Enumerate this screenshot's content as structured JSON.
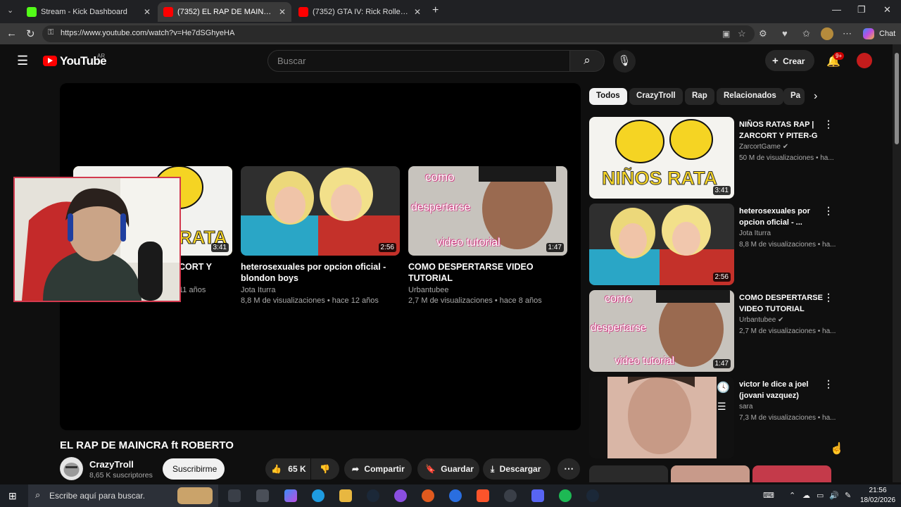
{
  "browser": {
    "tabs": [
      {
        "label": "Stream - Kick Dashboard",
        "favicon_color": "#53fc18"
      },
      {
        "label": "(7352) EL RAP DE MAINCRA ft ROBERTO",
        "favicon_color": "#ff0000"
      },
      {
        "label": "(7352) GTA IV: Rick Rolled EFLC (Or...",
        "favicon_color": "#ff0000"
      }
    ],
    "url": "https://www.youtube.com/watch?v=He7dSGhyeHA",
    "chat_label": "Chat"
  },
  "youtube": {
    "logo_text": "YouTube",
    "region": "AR",
    "search_placeholder": "Buscar",
    "create_label": "Crear",
    "notif_badge": "9+",
    "player_end_cards": [
      {
        "title": "NIÑOS RATAS RAP | ZARCORT Y PITER-G",
        "title_visible": "CORT Y",
        "meta_visible": "11 años",
        "duration": "3:41"
      },
      {
        "title": "heterosexuales por opcion oficial - blondon boys",
        "channel": "Jota Iturra",
        "meta": "8,8 M de visualizaciones • hace 12 años",
        "duration": "2:56"
      },
      {
        "title": "COMO DESPERTARSE VIDEO TUTORIAL",
        "channel": "Urbantubee",
        "meta": "2,7 M de visualizaciones • hace 8 años",
        "duration": "1:47",
        "thumb_text": [
          "como",
          "despertarse",
          "video tutorial"
        ]
      }
    ],
    "video": {
      "title": "EL RAP DE MAINCRA ft ROBERTO",
      "channel": "CrazyTroll",
      "subscribers": "8,65 K suscriptores",
      "subscribe_label": "Suscribirme",
      "likes": "65 K",
      "share_label": "Compartir",
      "save_label": "Guardar",
      "download_label": "Descargar"
    },
    "chips": [
      "Todos",
      "CrazyTroll",
      "Rap",
      "Relacionados",
      "Pa"
    ],
    "recommendations": [
      {
        "title": "NIÑOS RATAS RAP | ZARCORT Y PITER-G",
        "channel": "ZarcortGame",
        "views": "50 M de visualizaciones • ha...",
        "duration": "3:41",
        "thumb_text": "NIÑOS RATA",
        "verified": true
      },
      {
        "title": "heterosexuales por opcion oficial - ...",
        "channel": "Jota Iturra",
        "views": "8,8 M de visualizaciones • ha...",
        "duration": "2:56",
        "verified": false
      },
      {
        "title": "COMO DESPERTARSE VIDEO TUTORIAL",
        "channel": "Urbantubee",
        "views": "2,7 M de visualizaciones • ha...",
        "duration": "1:47",
        "verified": true
      },
      {
        "title": "victor le dice a joel (jovani vazquez)",
        "channel": "sara",
        "views": "7,3 M de visualizaciones • ha...",
        "verified": false
      }
    ]
  },
  "taskbar": {
    "search_placeholder": "Escribe aquí para buscar.",
    "time": "21:56",
    "date": "18/02/2026"
  },
  "colors": {
    "accent_red": "#ff0000",
    "bg": "#0f0f0f",
    "chip_bg": "#272727"
  }
}
